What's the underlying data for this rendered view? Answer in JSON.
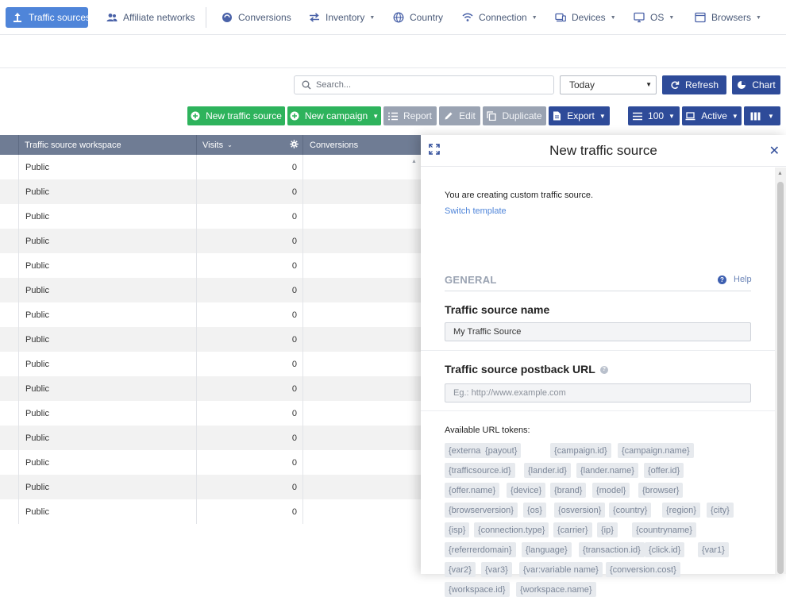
{
  "nav": {
    "tabs": [
      {
        "label": "Traffic sources",
        "icon": "traffic-source-icon",
        "active": true
      },
      {
        "label": "Affiliate networks",
        "icon": "people-icon"
      },
      {
        "label": "Conversions",
        "icon": "conversions-icon"
      },
      {
        "label": "Inventory",
        "icon": "exchange-arrows-icon",
        "dropdown": true
      },
      {
        "label": "Country",
        "icon": "globe-icon"
      },
      {
        "label": "Connection",
        "icon": "wifi-icon",
        "dropdown": true
      },
      {
        "label": "Devices",
        "icon": "devices-icon",
        "dropdown": true
      },
      {
        "label": "OS",
        "icon": "monitor-icon",
        "dropdown": true
      },
      {
        "label": "Browsers",
        "icon": "browser-window-icon",
        "dropdown": true
      }
    ]
  },
  "toolbar": {
    "search_placeholder": "Search...",
    "date_range": "Today",
    "refresh_label": "Refresh",
    "chart_label": "Chart",
    "new_traffic_source_label": "New traffic source",
    "new_campaign_label": "New campaign",
    "report_label": "Report",
    "edit_label": "Edit",
    "duplicate_label": "Duplicate",
    "export_label": "Export",
    "rows_per_page": "100",
    "status_filter": "Active"
  },
  "table": {
    "columns": [
      "Traffic source workspace",
      "Visits",
      "Conversions"
    ],
    "rows": [
      {
        "workspace": "Public",
        "visits": "0"
      },
      {
        "workspace": "Public",
        "visits": "0"
      },
      {
        "workspace": "Public",
        "visits": "0"
      },
      {
        "workspace": "Public",
        "visits": "0"
      },
      {
        "workspace": "Public",
        "visits": "0"
      },
      {
        "workspace": "Public",
        "visits": "0"
      },
      {
        "workspace": "Public",
        "visits": "0"
      },
      {
        "workspace": "Public",
        "visits": "0"
      },
      {
        "workspace": "Public",
        "visits": "0"
      },
      {
        "workspace": "Public",
        "visits": "0"
      },
      {
        "workspace": "Public",
        "visits": "0"
      },
      {
        "workspace": "Public",
        "visits": "0"
      },
      {
        "workspace": "Public",
        "visits": "0"
      },
      {
        "workspace": "Public",
        "visits": "0"
      },
      {
        "workspace": "Public",
        "visits": "0"
      }
    ]
  },
  "panel": {
    "title": "New traffic source",
    "intro": "You are creating custom traffic source.",
    "switch_template": "Switch template",
    "section_general": "GENERAL",
    "help": "Help",
    "name_label": "Traffic source name",
    "name_value": "My Traffic Source",
    "postback_label": "Traffic source postback URL",
    "postback_placeholder": "Eg.: http://www.example.com",
    "tokens_label": "Available URL tokens:",
    "tokens": [
      "{externalid}",
      "{payout}",
      "{campaign.id}",
      "{campaign.name}",
      "{trafficsource.id}",
      "{lander.id}",
      "{lander.name}",
      "{offer.id}",
      "{offer.name}",
      "{device}",
      "{brand}",
      "{model}",
      "{browser}",
      "{browserversion}",
      "{os}",
      "{osversion}",
      "{country}",
      "{region}",
      "{city}",
      "{isp}",
      "{connection.type}",
      "{carrier}",
      "{ip}",
      "{countryname}",
      "{referrerdomain}",
      "{language}",
      "{transaction.id}",
      "{click.id}",
      "{var1}",
      "{var2}",
      "{var3}",
      "{var:variable name}",
      "{conversion.cost}",
      "{workspace.id}",
      "{workspace.name}"
    ]
  },
  "colors": {
    "accent": "#4f85d9",
    "navy_button": "#2e4b99",
    "green_button": "#2eb35c",
    "disabled_button": "#9aa3b2",
    "table_header": "#6f7c94"
  }
}
